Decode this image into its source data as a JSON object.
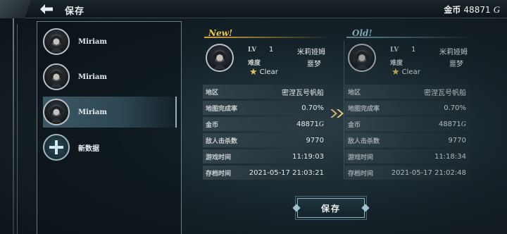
{
  "header": {
    "title": "保存",
    "currency_label": "金币",
    "currency_value": "48871",
    "currency_symbol": "G"
  },
  "slots": [
    {
      "name": "Miriam",
      "selected": false
    },
    {
      "name": "Miriam",
      "selected": false
    },
    {
      "name": "Miriam",
      "selected": true
    },
    {
      "name": "新数据",
      "selected": false
    }
  ],
  "compare": {
    "new": {
      "header": "New!",
      "lv_label": "LV",
      "lv_value": "1",
      "character": "米莉娅姆",
      "difficulty_label": "难度",
      "difficulty_value": "噩梦",
      "clear": "Clear",
      "rows": [
        {
          "key": "地区",
          "value": "密涅瓦号帆船"
        },
        {
          "key": "地图完成率",
          "value": "0.70%"
        },
        {
          "key": "金币",
          "value": "48871",
          "suffix": "G"
        },
        {
          "key": "敌人击杀数",
          "value": "9770"
        },
        {
          "key": "游戏时间",
          "value": "11:19:03"
        },
        {
          "key": "存档时间",
          "value": "2021-05-17 21:03:21"
        }
      ]
    },
    "old": {
      "header": "Old!",
      "lv_label": "LV",
      "lv_value": "1",
      "character": "米莉娅姆",
      "difficulty_label": "难度",
      "difficulty_value": "噩梦",
      "clear": "Clear",
      "rows": [
        {
          "key": "地区",
          "value": "密涅瓦号帆船"
        },
        {
          "key": "地图完成率",
          "value": "0.70%"
        },
        {
          "key": "金币",
          "value": "48871",
          "suffix": "G"
        },
        {
          "key": "敌人击杀数",
          "value": "9770"
        },
        {
          "key": "游戏时间",
          "value": "11:18:34"
        },
        {
          "key": "存档时间",
          "value": "2021-05-17 21:02:48"
        }
      ]
    }
  },
  "save_button": "保存",
  "colors": {
    "new_accent": "#e8c74e",
    "old_accent": "#7fa7b4",
    "selected_slot": "#3d5966"
  },
  "icons": {
    "back": "back-arrow-icon",
    "clear": "star-icon",
    "transfer": "double-chevron-right-icon",
    "add": "plus-icon"
  }
}
